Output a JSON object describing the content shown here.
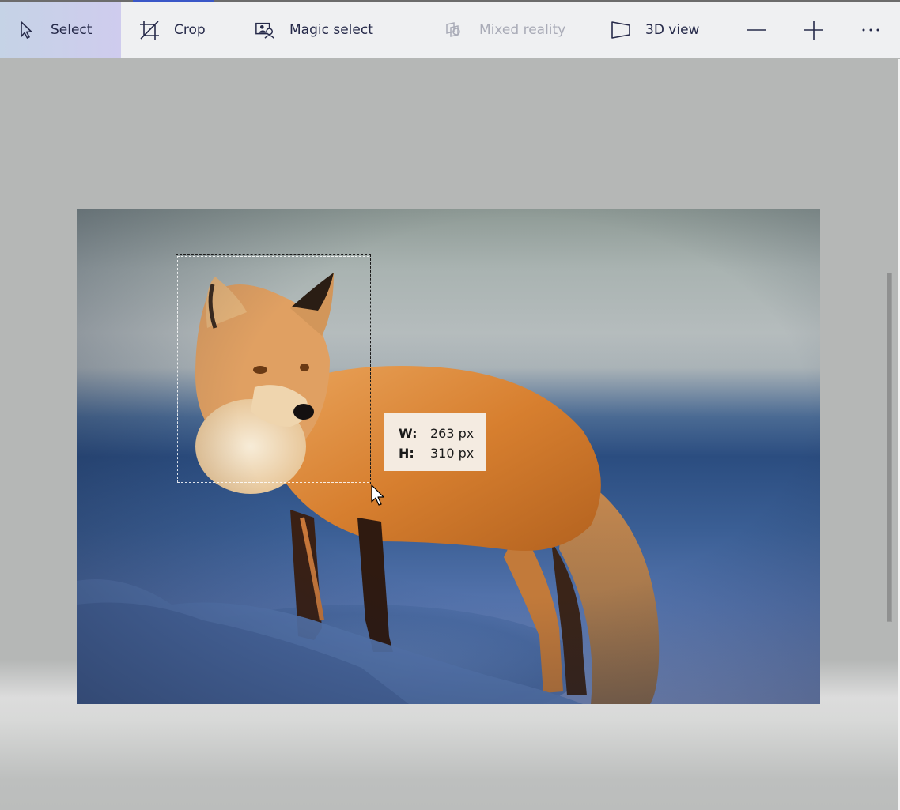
{
  "toolbar": {
    "tools": [
      {
        "id": "select",
        "label": "Select",
        "icon": "cursor-arrow-icon",
        "selected": true,
        "enabled": true
      },
      {
        "id": "crop",
        "label": "Crop",
        "icon": "crop-icon",
        "selected": false,
        "enabled": true
      },
      {
        "id": "magic_select",
        "label": "Magic select",
        "icon": "magic-select-icon",
        "selected": false,
        "enabled": true
      },
      {
        "id": "mixed_reality",
        "label": "Mixed reality",
        "icon": "mixed-reality-icon",
        "selected": false,
        "enabled": false
      },
      {
        "id": "3d_view",
        "label": "3D view",
        "icon": "3d-view-icon",
        "selected": false,
        "enabled": true
      }
    ],
    "zoom_out_icon": "minus-icon",
    "zoom_in_icon": "plus-icon",
    "more_icon": "ellipsis-icon"
  },
  "canvas": {
    "image_subject": "Red fox standing on snow",
    "selection": {
      "width_label": "W:",
      "width_value": "263 px",
      "height_label": "H:",
      "height_value": "310 px"
    }
  },
  "colors": {
    "toolbar_bg": "#eff0f2",
    "selected_tool_bg": "#cfccee",
    "tool_text": "#262a4a",
    "disabled_text": "#a9abb7",
    "canvas_bg": "#b5b7b6",
    "tooltip_bg": "#f4ebe1"
  }
}
